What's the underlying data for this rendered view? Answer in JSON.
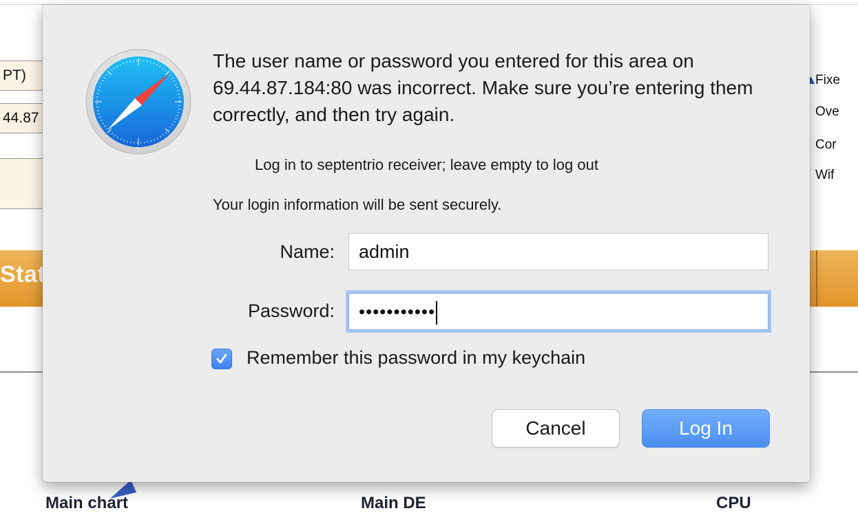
{
  "background_page": {
    "field_1_fragment": "PT)",
    "field_2_fragment": "44.87",
    "status_band_fragment": "Stat",
    "legend": [
      {
        "icon": "triangle-icon",
        "color": "#2a4fb0",
        "label": "Fixe"
      },
      {
        "icon": "bar-icon",
        "color": "#3cb23c",
        "label": "Ove"
      },
      {
        "icon": "wave-icon",
        "color": "#c0392b",
        "label": "Cor"
      },
      {
        "icon": "wave-icon",
        "color": "#c0392b",
        "label": "Wif"
      }
    ],
    "bottom_labels": [
      "Main chart",
      "Main DE",
      "CPU"
    ]
  },
  "dialog": {
    "app_icon": "safari-compass-icon",
    "message": "The user name or password you entered for this area on 69.44.87.184:80 was incorrect. Make sure you’re entering them correctly, and then try again.",
    "realm": "Log in to septentrio receiver; leave empty to log out",
    "secure_note": "Your login information will be sent securely.",
    "name_label": "Name:",
    "name_value": "admin",
    "password_label": "Password:",
    "password_mask": "•••••••••••",
    "remember_checked": true,
    "remember_label": "Remember this password in my keychain",
    "cancel_label": "Cancel",
    "login_label": "Log In",
    "accent_color": "#4a8ff0"
  }
}
